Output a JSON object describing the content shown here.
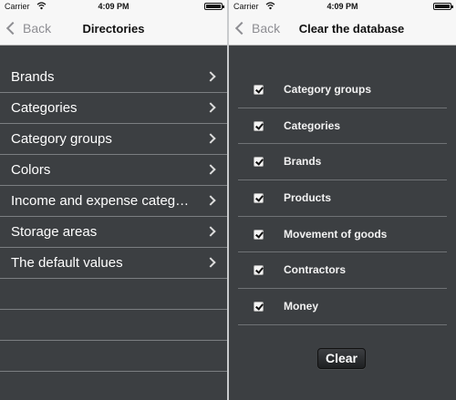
{
  "status": {
    "carrier": "Carrier",
    "time": "4:09 PM"
  },
  "left": {
    "back_label": "Back",
    "title": "Directories",
    "items": [
      {
        "label": "Brands"
      },
      {
        "label": "Categories"
      },
      {
        "label": "Category groups"
      },
      {
        "label": "Colors"
      },
      {
        "label": "Income and expense categ…"
      },
      {
        "label": "Storage areas"
      },
      {
        "label": "The default values"
      }
    ]
  },
  "right": {
    "back_label": "Back",
    "title": "Clear the database",
    "items": [
      {
        "label": "Category groups",
        "checked": true
      },
      {
        "label": "Categories",
        "checked": true
      },
      {
        "label": "Brands",
        "checked": true
      },
      {
        "label": "Products",
        "checked": true
      },
      {
        "label": "Movement of goods",
        "checked": true
      },
      {
        "label": "Contractors",
        "checked": true
      },
      {
        "label": "Money",
        "checked": true
      }
    ],
    "clear_label": "Clear"
  }
}
